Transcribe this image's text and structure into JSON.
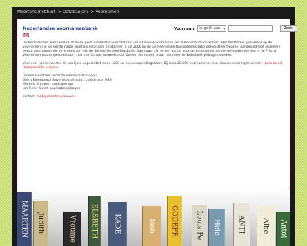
{
  "breadcrumb": "Meertens Instituut -> Databanken -> Voornamen",
  "title": "Nederlandse Voornamenbank",
  "flag_icon": "uk-flag-icon",
  "search": {
    "label": "Voornaam",
    "mode": "is gelijk aan",
    "value": "",
    "button": "Zoek!"
  },
  "intro": {
    "paragraph1": "De Nederlandse Voornamen Databank geeft informatie over 500.000 verschillende voornamen die in Nederland voorkomen. Het bestand is gebaseerd op de voornamen die als eerste naam en/of als volgnaam ontstonden 1 juli 2006 bij de Gemeentelijke Basisadministratie geregistreerd waren, aangevuld met recentere eerste voornamen die verkregen zijn van de Sociale Verzekeringsbank. Daarnaast zijn er een aantal voornamen opgenomen die gevonden werden in de Prisma Voornamen (samengesteld door J. van der Schaar, bewerkt door Doreen Gerritzen), maar niet meer in Nederland gedragen worden.",
    "paragraph2_text": "Voor veel namen vindt u de jaarlijkse populariteit sinds 1880 en een verspreidingskaart. Bij circa 20.000 voornamen is een naamsverklaring te vinden.",
    "link_lees_meer": "[Lees meer]",
    "link_vragen": "[Veelgestelde vragen]"
  },
  "credits": [
    "Doreen Gerritzen, redactie naamsverklaringen",
    "Gerrit Bloothooft (Universiteit Utrecht), coördinator GBA",
    "Matthijs Brouwer, programmeur",
    "Jan Pieter Kunst, applicatiebijdragen"
  ],
  "contact": {
    "label": "contact:",
    "email": "mnb@meertens.knaw.nl"
  },
  "books": [
    {
      "title": "MAARTEN",
      "color": "#3c4a78",
      "text_color": "#e8e0c8"
    },
    {
      "title": "Judith",
      "color": "#c9b98a",
      "text_color": "#222222"
    },
    {
      "title": "Vroume",
      "color": "#2a2a2a",
      "text_color": "#d8d0b0"
    },
    {
      "title": "ELSBETH",
      "color": "#3d5a3a",
      "text_color": "#e8d070"
    },
    {
      "title": "KADE",
      "color": "#4a5a7a",
      "text_color": "#e8e8e8"
    },
    {
      "title": "Isab",
      "color": "#d8b070",
      "text_color": "#ffffff"
    },
    {
      "title": "GODEFR",
      "color": "#e8c030",
      "text_color": "#7a2a1a"
    },
    {
      "title": "Louis Pe",
      "color": "#dcd6c8",
      "text_color": "#333333"
    },
    {
      "title": "Hele",
      "color": "#7a9ab0",
      "text_color": "#ffffff"
    },
    {
      "title": "ANTI",
      "color": "#e8e4d8",
      "text_color": "#333333"
    },
    {
      "title": "Albe",
      "color": "#f0ecd8",
      "text_color": "#333333"
    },
    {
      "title": "Antoi",
      "color": "#3a6a3a",
      "text_color": "#ffffff"
    }
  ]
}
